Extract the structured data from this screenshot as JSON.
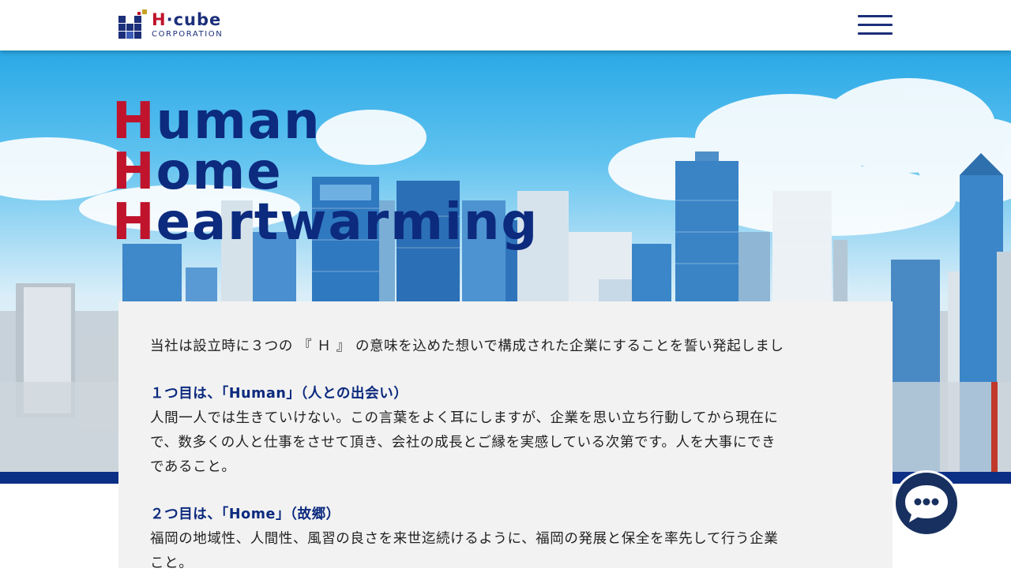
{
  "header": {
    "logo": {
      "brand_prefix": "H",
      "brand_dot": "·",
      "brand_rest": "cube",
      "sub": "CORPORATION"
    },
    "menu_icon": "hamburger-menu-icon"
  },
  "hero": {
    "lines": [
      {
        "cap": "H",
        "rest": "uman"
      },
      {
        "cap": "H",
        "rest": "ome"
      },
      {
        "cap": "H",
        "rest": "eartwarming"
      }
    ]
  },
  "content": {
    "intro": "当社は設立時に３つの 『 Ｈ 』 の意味を込めた想いで構成された企業にすることを誓い発起しまし",
    "item1_heading": "１つ目は、「Human」（人との出会い）",
    "item1_body_1": "人間一人では生きていけない。この言葉をよく耳にしますが、企業を思い立ち行動してから現在に",
    "item1_body_2": "で、数多くの人と仕事をさせて頂き、会社の成長とご縁を実感している次第です。人を大事にでき",
    "item1_body_3": "であること。",
    "item2_heading": "２つ目は、「Home」（故郷）",
    "item2_body_1": "福岡の地域性、人間性、風習の良さを来世迄続けるように、福岡の発展と保全を率先して行う企業",
    "item2_body_2": "こと。"
  },
  "chat": {
    "icon": "chat-bubble-icon"
  },
  "colors": {
    "brand_blue": "#0c2a7e",
    "brand_red": "#c0132c",
    "hero_bar": "#0c2f86",
    "card_bg": "#f2f2f2",
    "chat_bg": "#18305f"
  }
}
